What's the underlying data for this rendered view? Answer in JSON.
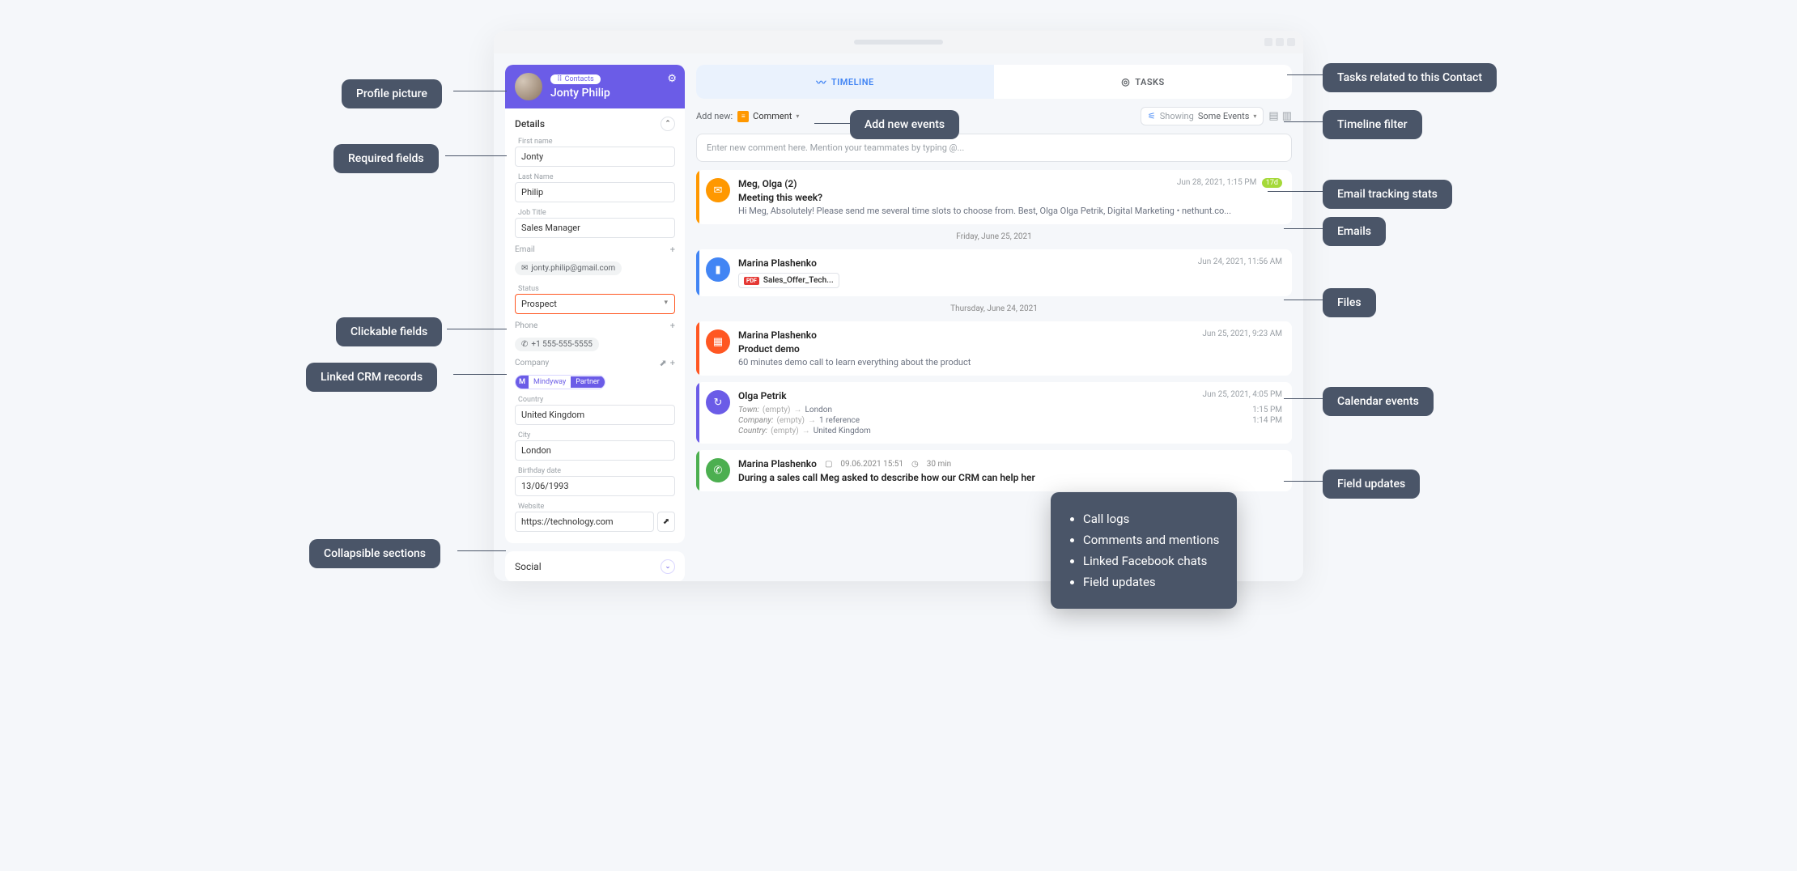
{
  "callouts": {
    "profile_picture": "Profile picture",
    "required_fields": "Required fields",
    "clickable_fields": "Clickable fields",
    "linked_crm": "Linked CRM records",
    "collapsible": "Collapsible sections",
    "tasks_related": "Tasks related to this Contact",
    "timeline_filter": "Timeline filter",
    "tracking_stats": "Email tracking stats",
    "emails": "Emails",
    "files": "Files",
    "calendar_events": "Calendar events",
    "field_updates": "Field updates",
    "add_new_events": "Add new events"
  },
  "popover": {
    "items": [
      "Call logs",
      "Comments and mentions",
      "Linked Facebook chats",
      "Field updates"
    ]
  },
  "contact": {
    "folder_label": "Contacts",
    "name": "Jonty Philip",
    "details_label": "Details",
    "fields": {
      "first_name_label": "First name",
      "first_name": "Jonty",
      "last_name_label": "Last Name",
      "last_name": "Philip",
      "job_title_label": "Job Title",
      "job_title": "Sales Manager",
      "email_label": "Email",
      "email": "jonty.philip@gmail.com",
      "status_label": "Status",
      "status": "Prospect",
      "phone_label": "Phone",
      "phone": "+1 555-555-5555",
      "company_label": "Company",
      "company_name": "Mindyway",
      "company_role": "Partner",
      "country_label": "Country",
      "country": "United Kingdom",
      "city_label": "City",
      "city": "London",
      "birthday_label": "Birthday date",
      "birthday": "13/06/1993",
      "website_label": "Website",
      "website": "https://technology.com"
    },
    "social_label": "Social"
  },
  "tabs": {
    "timeline": "TIMELINE",
    "tasks": "TASKS"
  },
  "toolbar": {
    "add_new_label": "Add new:",
    "comment_option": "Comment",
    "showing_label": "Showing",
    "showing_value": "Some Events"
  },
  "comment_placeholder": "Enter new comment here. Mention your teammates by typing @...",
  "timeline": {
    "email": {
      "author": "Meg, Olga (2)",
      "time": "Jun 28, 2021, 1:15 PM",
      "views": "17d",
      "subject": "Meeting this week?",
      "preview": "Hi Meg, Absolutely! Please send me several time slots to choose from. Best, Olga Olga Petrik, Digital Marketing • nethunt.co..."
    },
    "sep1": "Friday, June 25, 2021",
    "file": {
      "author": "Marina Plashenko",
      "time": "Jun 24, 2021, 11:56 AM",
      "filename": "Sales_Offer_Tech..."
    },
    "sep2": "Thursday, June 24, 2021",
    "calendar": {
      "author": "Marina Plashenko",
      "time": "Jun 25, 2021, 9:23 AM",
      "title": "Product demo",
      "desc": "60 minutes demo call to learn everything about the product"
    },
    "update": {
      "author": "Olga Petrik",
      "time": "Jun 25, 2021, 4:05 PM",
      "changes": [
        {
          "field": "Town:",
          "old": "(empty)",
          "new": "London",
          "at": "1:15 PM"
        },
        {
          "field": "Company:",
          "old": "(empty)",
          "new": "1 reference",
          "at": "1:14 PM"
        },
        {
          "field": "Country:",
          "old": "(empty)",
          "new": "United Kingdom",
          "at": ""
        }
      ]
    },
    "call": {
      "author": "Marina Plashenko",
      "date": "09.06.2021 15:51",
      "duration": "30 min",
      "desc": "During a sales call Meg asked to describe how our CRM can help her"
    }
  }
}
